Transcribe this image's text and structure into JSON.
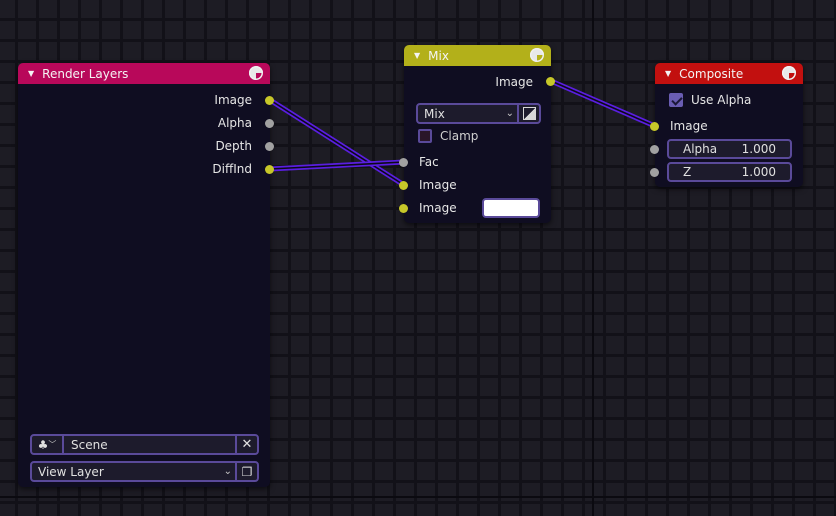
{
  "editor": "Compositor Node Editor",
  "colors": {
    "render_layers_header": "#b8085a",
    "mix_header": "#b3b01a",
    "composite_header": "#c2100f",
    "link": "#5a1ee0",
    "socket_color": "#c7c729",
    "socket_value": "#a1a1a1"
  },
  "nodes": {
    "render_layers": {
      "title": "Render Layers",
      "outputs": [
        {
          "label": "Image",
          "type": "color"
        },
        {
          "label": "Alpha",
          "type": "value"
        },
        {
          "label": "Depth",
          "type": "value"
        },
        {
          "label": "DiffInd",
          "type": "color"
        }
      ],
      "scene_field": "Scene",
      "view_layer_field": "View Layer"
    },
    "mix": {
      "title": "Mix",
      "output": "Image",
      "blend_mode": "Mix",
      "clamp_label": "Clamp",
      "clamp_checked": false,
      "inputs": [
        {
          "label": "Fac",
          "type": "value"
        },
        {
          "label": "Image",
          "type": "color"
        },
        {
          "label": "Image",
          "type": "color",
          "value_color": "#ffffff"
        }
      ]
    },
    "composite": {
      "title": "Composite",
      "use_alpha_label": "Use Alpha",
      "use_alpha_checked": true,
      "inputs": [
        {
          "label": "Image",
          "type": "color"
        },
        {
          "label": "Alpha",
          "value": "1.000",
          "type": "value"
        },
        {
          "label": "Z",
          "value": "1.000",
          "type": "value"
        }
      ]
    }
  },
  "links": [
    {
      "from": "Render Layers.Image",
      "to": "Mix.Image(1)"
    },
    {
      "from": "Render Layers.DiffInd",
      "to": "Mix.Fac"
    },
    {
      "from": "Mix.Image",
      "to": "Composite.Image"
    }
  ]
}
